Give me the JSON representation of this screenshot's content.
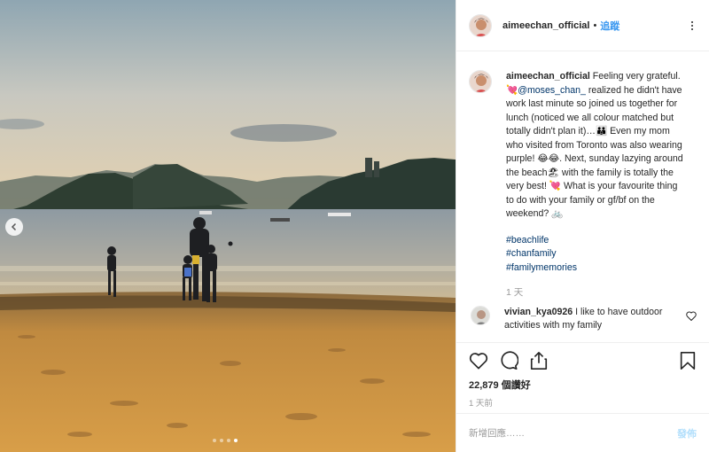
{
  "post": {
    "username": "aimeechan_official",
    "separator": "•",
    "follow_label": "追蹤",
    "caption": {
      "username": "aimeechan_official",
      "part1": " Feeling very grateful. 💘",
      "mention": "@moses_chan_",
      "part2": " realized he didn't have work last minute so joined us together for lunch (noticed we all colour matched but totally didn't plan it)…👪 Even my mom who visited from Toronto was also wearing purple! 😂😂. Next, sunday lazying around the beach🏖 with the family is totally the very best! 💘 What is your favourite thing to do with your family or gf/bf on the weekend? 🚲"
    },
    "hashtags": [
      "#beachlife",
      "#chanfamily",
      "#familymemories"
    ],
    "caption_time": "1 天",
    "comment": {
      "username": "vivian_kya0926",
      "text": " I like to have outdoor activities with my family"
    },
    "likes": "22,879 個讚好",
    "post_time": "1 天前",
    "add_comment_placeholder": "新增回應……",
    "post_label": "發佈"
  },
  "carousel": {
    "slides": 4,
    "active_index": 3
  },
  "icons": {
    "prev": "chevron-left-icon",
    "like": "heart-icon",
    "comment": "comment-icon",
    "share": "share-icon",
    "save": "bookmark-icon",
    "more": "more-options-icon"
  },
  "colors": {
    "link": "#003569",
    "follow": "#3897f0",
    "muted": "#999999",
    "post_disabled": "#b2dffc"
  }
}
